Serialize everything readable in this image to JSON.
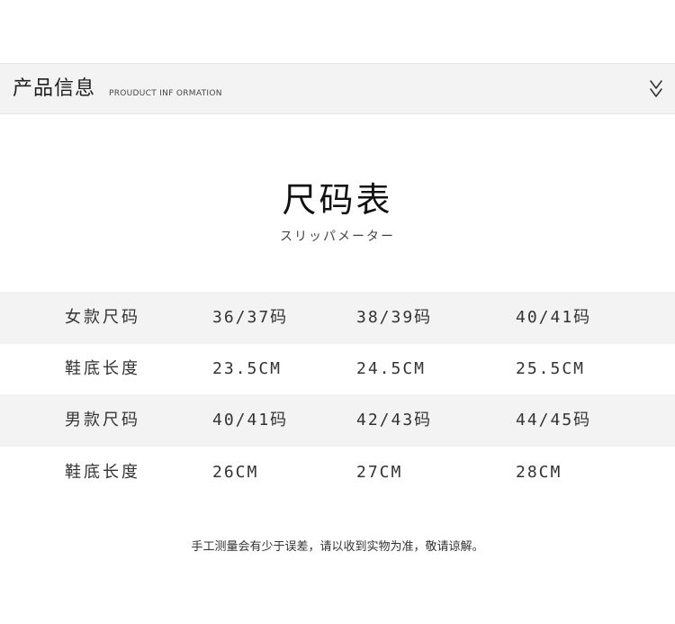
{
  "header": {
    "title": "产品信息",
    "subtitle": "PROUDUCT INF ORMATION",
    "icon": "double-chevron-down-icon"
  },
  "main": {
    "title": "尺码表",
    "subtitle": "スリッパメーター"
  },
  "table": {
    "rows": [
      {
        "label": "女款尺码",
        "cells": [
          "36/37码",
          "38/39码",
          "40/41码"
        ]
      },
      {
        "label": "鞋底长度",
        "cells": [
          "23.5CM",
          "24.5CM",
          "25.5CM"
        ]
      },
      {
        "label": "男款尺码",
        "cells": [
          "40/41码",
          "42/43码",
          "44/45码"
        ]
      },
      {
        "label": "鞋底长度",
        "cells": [
          "26CM",
          "27CM",
          "28CM"
        ]
      }
    ]
  },
  "note": "手工测量会有少于误差，请以收到实物为准，敬请谅解。",
  "colors": {
    "background": "#ffffff",
    "band": "#f3f3f3",
    "text": "#333333"
  }
}
